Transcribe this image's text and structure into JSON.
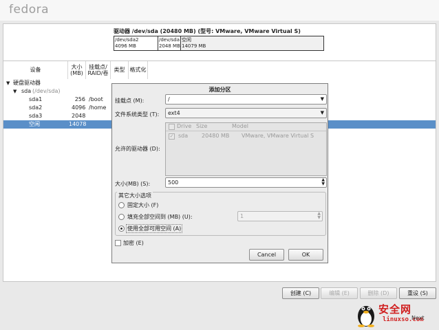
{
  "app": {
    "logo": "fedora"
  },
  "disk": {
    "title": "驱动器 /dev/sda (20480 MB) (型号: VMware, VMware Virtual S)",
    "segments": [
      {
        "name": "/dev/sda2",
        "size": "4096 MB"
      },
      {
        "name": "/dev/sda",
        "size": "2048 MB"
      },
      {
        "name": "空闲",
        "size": "14079 MB"
      }
    ]
  },
  "tree": {
    "headers": {
      "device": "设备",
      "size": "大小\n(MB)",
      "mount": "挂载点/\nRAID/卷",
      "type": "类型",
      "format": "格式化"
    },
    "rows": [
      {
        "device": "硬盘驱动器",
        "size": "",
        "mount": ""
      },
      {
        "device": "sda",
        "sub": "(/dev/sda)",
        "size": "",
        "mount": ""
      },
      {
        "device": "sda1",
        "size": "256",
        "mount": "/boot"
      },
      {
        "device": "sda2",
        "size": "4096",
        "mount": "/home"
      },
      {
        "device": "sda3",
        "size": "2048",
        "mount": ""
      },
      {
        "device": "空闲",
        "size": "14078",
        "mount": ""
      }
    ]
  },
  "buttons": {
    "create": "创建 (C)",
    "edit": "编辑 (E)",
    "delete": "删除 (D)",
    "reset": "重设 (S)",
    "next": "Next"
  },
  "dialog": {
    "title": "添加分区",
    "mount_label": "挂载点 (M):",
    "mount_value": "/",
    "fstype_label": "文件系统类型 (T):",
    "fstype_value": "ext4",
    "drives_label": "允许的驱动器 (D):",
    "drives_headers": [
      "Drive",
      "Size",
      "Model"
    ],
    "drive_row": {
      "drive": "sda",
      "size": "20480 MB",
      "model": "VMware, VMware Virtual S"
    },
    "size_label": "大小(MB) (S):",
    "size_value": "500",
    "other_label": "其它大小选项",
    "opt_fixed": "固定大小 (F)",
    "opt_fill_upto": "填充全部空间到 (MB) (U):",
    "fill_value": "1",
    "opt_fill_max": "使用全部可用空间 (A)",
    "encrypt_label": "加密 (E)",
    "cancel": "Cancel",
    "ok": "OK"
  },
  "watermark": {
    "text": "安全网",
    "url": "linuxso.com"
  },
  "colors": {
    "selection": "#5a8fc8",
    "watermark": "#d02020"
  }
}
